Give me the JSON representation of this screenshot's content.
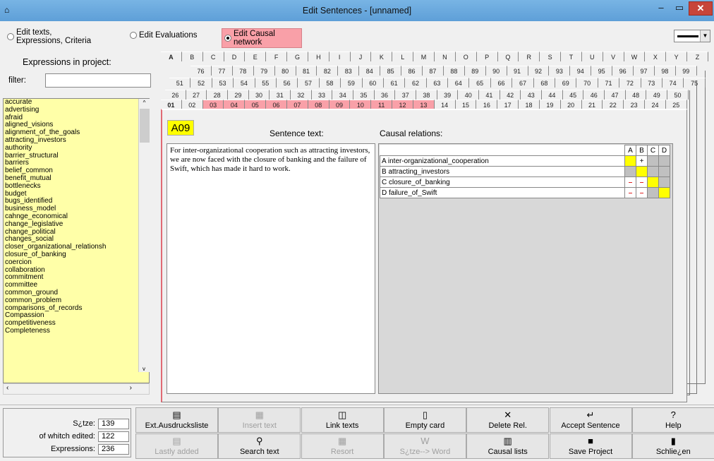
{
  "window": {
    "title": "Edit Sentences - [unnamed]"
  },
  "modes": [
    {
      "label_line1": "Edit texts,",
      "label_line2": "Expressions, Criteria",
      "selected": false
    },
    {
      "label": "Edit Evaluations",
      "selected": false
    },
    {
      "label_line1": "Edit Causal",
      "label_line2": "network",
      "selected": true
    }
  ],
  "left_panel": {
    "title": "Expressions in project:",
    "filter_label": "filter:",
    "filter_value": "",
    "expressions": [
      "accurate",
      "advertising",
      "afraid",
      "aligned_visions",
      "alignment_of_the_goals",
      "attracting_investors",
      "authority",
      "barrier_structural",
      "barriers",
      "belief_common",
      "benefit_mutual",
      "bottlenecks",
      "budget",
      "bugs_identified",
      "business_model",
      "cahnge_economical",
      "change_legislative",
      "change_political",
      "changes_social",
      "closer_organizational_relationsh",
      "closure_of_banking",
      "coercion",
      "collaboration",
      "commitment",
      "committee",
      "common_ground",
      "common_problem",
      "comparisons_of_records",
      "Compassion",
      "competitiveness",
      "Completeness"
    ]
  },
  "tabs": {
    "letters": [
      "A",
      "B",
      "C",
      "D",
      "E",
      "F",
      "G",
      "H",
      "I",
      "J",
      "K",
      "L",
      "M",
      "N",
      "O",
      "P",
      "Q",
      "R",
      "S",
      "T",
      "U",
      "V",
      "W",
      "X",
      "Y",
      "Z"
    ],
    "row1": [
      "76",
      "77",
      "78",
      "79",
      "80",
      "81",
      "82",
      "83",
      "84",
      "85",
      "86",
      "87",
      "88",
      "89",
      "90",
      "91",
      "92",
      "93",
      "94",
      "95",
      "96",
      "97",
      "98",
      "99"
    ],
    "row2": [
      "51",
      "52",
      "53",
      "54",
      "55",
      "56",
      "57",
      "58",
      "59",
      "60",
      "61",
      "62",
      "63",
      "64",
      "65",
      "66",
      "67",
      "68",
      "69",
      "70",
      "71",
      "72",
      "73",
      "74",
      "75"
    ],
    "row3": [
      "26",
      "27",
      "28",
      "29",
      "30",
      "31",
      "32",
      "33",
      "34",
      "35",
      "36",
      "37",
      "38",
      "39",
      "40",
      "41",
      "42",
      "43",
      "44",
      "45",
      "46",
      "47",
      "48",
      "49",
      "50"
    ],
    "row4": [
      "01",
      "02",
      "03",
      "04",
      "05",
      "06",
      "07",
      "08",
      "09",
      "10",
      "11",
      "12",
      "13",
      "14",
      "15",
      "16",
      "17",
      "18",
      "19",
      "20",
      "21",
      "22",
      "23",
      "24",
      "25"
    ],
    "row4_pink": [
      "03",
      "04",
      "05",
      "06",
      "07",
      "08",
      "09",
      "10",
      "11",
      "12",
      "13"
    ]
  },
  "card": {
    "sentence_id": "A09",
    "sentence_label": "Sentence text:",
    "causal_label": "Causal relations:",
    "sentence_text": "For inter-organizational cooperation such as attracting investors, we are now faced with the closure of banking and the failure of Swift, which has made it hard to work.",
    "matrix": {
      "headers": [
        "A",
        "B",
        "C",
        "D"
      ],
      "rows": [
        {
          "name": "A  inter-organizational_cooperation",
          "cells": [
            {
              "v": "",
              "c": "y"
            },
            {
              "v": "+",
              "c": "w"
            },
            {
              "v": "",
              "c": "g"
            },
            {
              "v": "",
              "c": "g"
            }
          ]
        },
        {
          "name": "B  attracting_investors",
          "cells": [
            {
              "v": "",
              "c": "g"
            },
            {
              "v": "",
              "c": "y"
            },
            {
              "v": "",
              "c": "g"
            },
            {
              "v": "",
              "c": "g"
            }
          ]
        },
        {
          "name": "C  closure_of_banking",
          "cells": [
            {
              "v": "–",
              "c": "w"
            },
            {
              "v": "–",
              "c": "w"
            },
            {
              "v": "",
              "c": "y"
            },
            {
              "v": "",
              "c": "g"
            }
          ]
        },
        {
          "name": "D  failure_of_Swift",
          "cells": [
            {
              "v": "–",
              "c": "w"
            },
            {
              "v": "–",
              "c": "w"
            },
            {
              "v": "",
              "c": "g"
            },
            {
              "v": "",
              "c": "y"
            }
          ]
        }
      ]
    }
  },
  "counts": {
    "saetze_label": "S¿tze:",
    "saetze_value": "139",
    "edited_label": "of whitch edited:",
    "edited_value": "122",
    "expr_label": "Expressions:",
    "expr_value": "236"
  },
  "toolbar": {
    "row1": [
      {
        "label": "Ext.Ausdrucksliste",
        "icon": "▤",
        "disabled": false,
        "name": "ext-ausdrucksliste-button"
      },
      {
        "label": "Insert text",
        "icon": "▦",
        "disabled": true,
        "name": "insert-text-button"
      },
      {
        "label": "Link texts",
        "icon": "◫",
        "disabled": false,
        "name": "link-texts-button"
      },
      {
        "label": "Empty card",
        "icon": "▯",
        "disabled": false,
        "name": "empty-card-button"
      },
      {
        "label": "Delete Rel.",
        "icon": "✕",
        "disabled": false,
        "name": "delete-rel-button"
      },
      {
        "label": "Accept Sentence",
        "icon": "↵",
        "disabled": false,
        "name": "accept-sentence-button"
      },
      {
        "label": "Help",
        "icon": "?",
        "disabled": false,
        "name": "help-button"
      }
    ],
    "row2": [
      {
        "label": "Lastly added",
        "icon": "▤",
        "disabled": true,
        "name": "lastly-added-button"
      },
      {
        "label": "Search text",
        "icon": "⚲",
        "disabled": false,
        "name": "search-text-button"
      },
      {
        "label": "Resort",
        "icon": "▦",
        "disabled": true,
        "name": "resort-button"
      },
      {
        "label": "S¿tze--> Word",
        "icon": "W",
        "disabled": true,
        "name": "saetze-word-button"
      },
      {
        "label": "Causal lists",
        "icon": "▥",
        "disabled": false,
        "name": "causal-lists-button"
      },
      {
        "label": "Save Project",
        "icon": "■",
        "disabled": false,
        "name": "save-project-button"
      },
      {
        "label": "Schlie¿en",
        "icon": "▮",
        "disabled": false,
        "name": "schliessen-button"
      }
    ]
  },
  "colors": {
    "pink": "#f9a0a8",
    "yellow_list": "#ffffa8",
    "highlight_yellow": "#ffff00",
    "title_bar": "#6aa9de"
  }
}
